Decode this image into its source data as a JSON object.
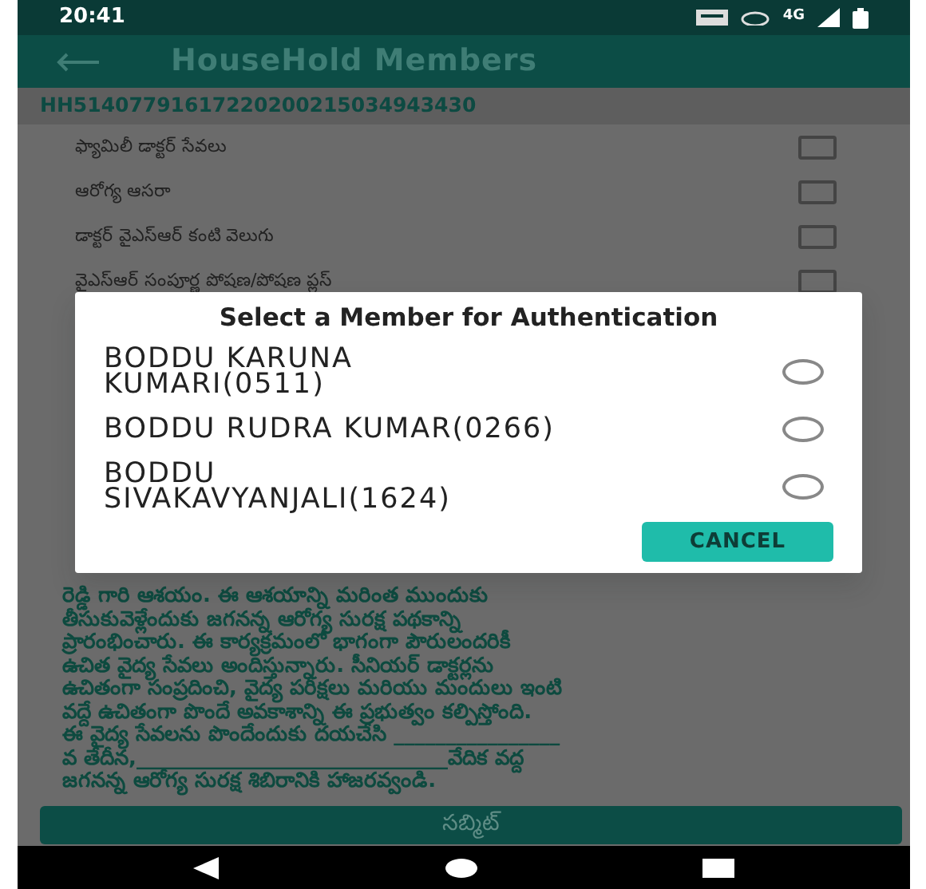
{
  "status_bar": {
    "time": "20:41",
    "network": "4G"
  },
  "app_bar": {
    "title": "HouseHold Members"
  },
  "household_id": "HH51407791617220200215034943430",
  "services": [
    {
      "label": "ఫ్యామిలీ డాక్టర్ సేవలు",
      "checked": false
    },
    {
      "label": "ఆరోగ్య ఆసరా",
      "checked": false
    },
    {
      "label": "డాక్టర్ వైఎస్ఆర్ కంటి వెలుగు",
      "checked": false
    },
    {
      "label": "వైఎస్ఆర్ సంపూర్ణ పోషణ/పోషణ ప్లస్",
      "checked": false
    }
  ],
  "message": "రెడ్డి గారి ఆశయం. ఈ ఆశయాన్ని మరింత ముందుకు\nతీసుకువెళ్లేందుకు జగనన్న ఆరోగ్య సురక్ష పథకాన్ని\nప్రారంభించారు. ఈ కార్యక్రమంలో భాగంగా పౌరులందరికీ\nఉచిత వైద్య సేవలు అందిస్తున్నారు.  సీనియర్ డాక్టర్లను\nఉచితంగా సంప్రదించి, వైద్య పరీక్షలు మరియు మందులు ఇంటి\nవద్దే ఉచితంగా పొందే అవకాశాన్ని ఈ ప్రభుత్వం కల్పిస్తోంది.\nఈ వైద్య సేవలను పొందేందుకు దయచేసి ________________\nవ తేదీన,______________________________వేదిక వద్ద\nజగనన్న ఆరోగ్య సురక్ష శిబిరానికి హాజరవ్వండి.",
  "submit_button": "సబ్మిట్",
  "dialog": {
    "title": "Select a Member for Authentication",
    "members": [
      {
        "name": "BODDU KARUNA\nKUMARI(0511)",
        "selected": false
      },
      {
        "name": "BODDU RUDRA KUMAR(0266)",
        "selected": false
      },
      {
        "name": "BODDU\nSIVAKAVYANJALI(1624)",
        "selected": false
      }
    ],
    "buttons": [
      "CANCEL"
    ]
  }
}
